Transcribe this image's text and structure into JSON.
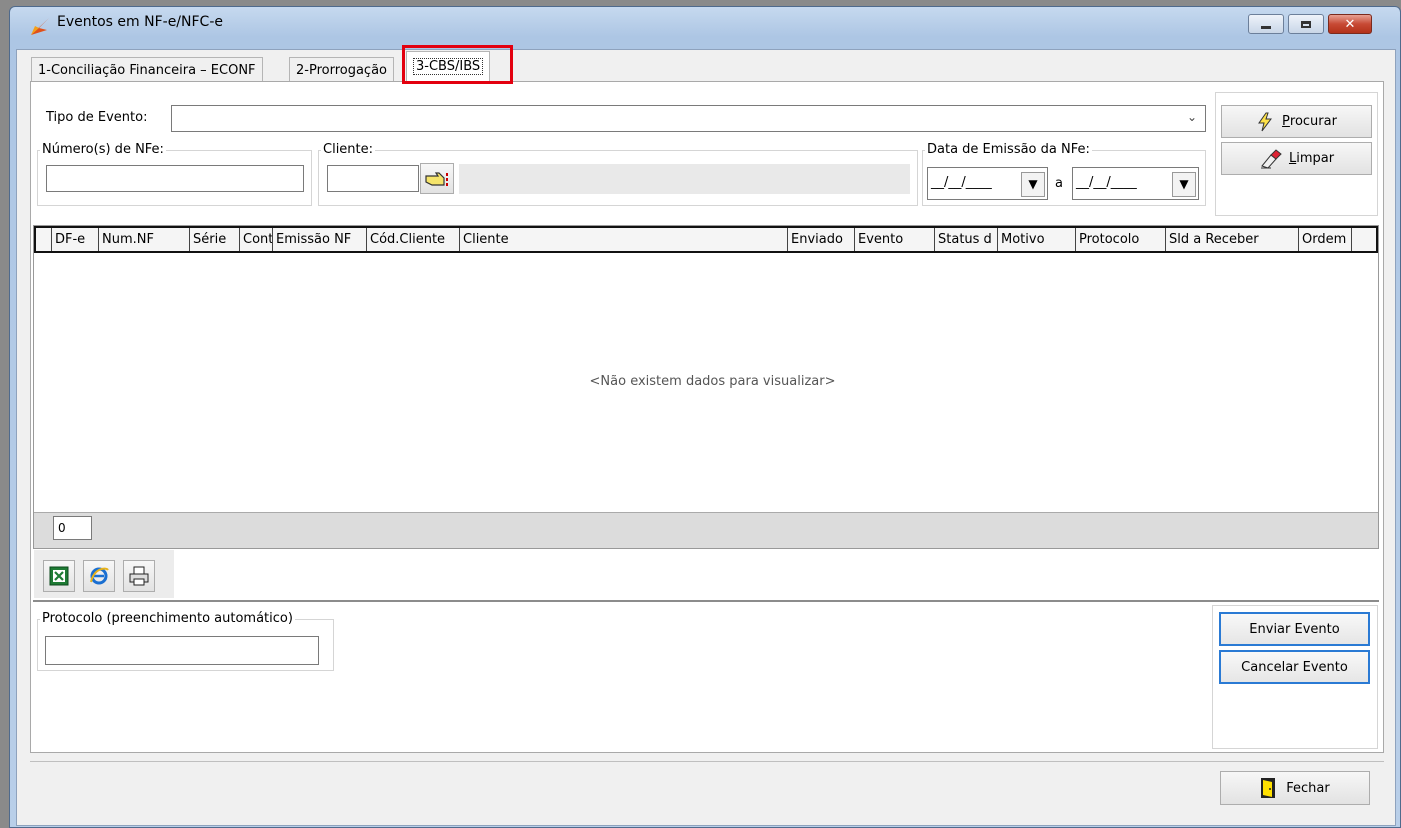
{
  "window": {
    "title": "Eventos em NF-e/NFC-e",
    "min_label": "‒",
    "max_label": "▫",
    "close_label": "✕"
  },
  "tabs": [
    {
      "label": "1-Conciliação Financeira – ECONF"
    },
    {
      "label": "2-Prorrogação"
    },
    {
      "label": "3-CBS/IBS"
    }
  ],
  "filters": {
    "tipo_evento_label": "Tipo de Evento:",
    "tipo_evento_value": "",
    "numeros_nfe_label": "Número(s) de NFe:",
    "numeros_nfe_value": "",
    "cliente_label": "Cliente:",
    "cliente_code": "",
    "cliente_name": "",
    "data_emissao_label": "Data de Emissão da NFe:",
    "data_de": "__/__/____",
    "data_sep": "a",
    "data_ate": "__/__/____"
  },
  "actions": {
    "procurar_prefix": "P",
    "procurar_rest": "rocurar",
    "limpar_prefix": "L",
    "limpar_rest": "impar"
  },
  "grid": {
    "columns": [
      "DF-e",
      "Num.NF",
      "Série",
      "Conta",
      "Emissão NF",
      "Cód.Cliente",
      "Cliente",
      "Enviado",
      "Evento",
      "Status d",
      "Motivo",
      "Protocolo",
      "Sld a Receber",
      "Ordem"
    ],
    "empty_message": "<Não existem dados para visualizar>",
    "row_count": "0"
  },
  "protocolo": {
    "label": "Protocolo (preenchimento automático)",
    "value": ""
  },
  "buttons": {
    "enviar": "Enviar Evento",
    "cancelar": "Cancelar Evento",
    "fechar": "Fechar"
  },
  "icons": {
    "app": "app-logo-icon",
    "excel": "excel-export-icon",
    "ie": "browser-export-icon",
    "print": "printer-icon",
    "procurar": "lightning-icon",
    "limpar": "eraser-icon",
    "fechar": "exit-door-icon",
    "lookup": "pointing-hand-icon"
  },
  "colors": {
    "highlight": "#e3000f",
    "blue_button_border": "#2a7ad4"
  }
}
